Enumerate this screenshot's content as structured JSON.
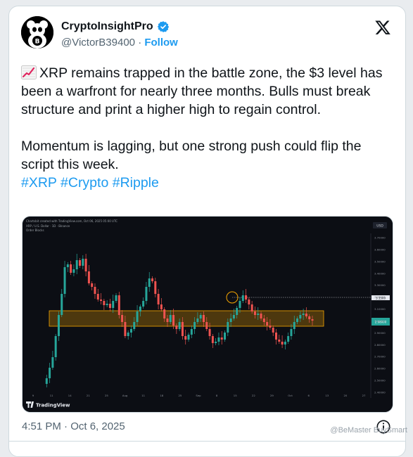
{
  "author": {
    "display_name": "CryptoInsightPro",
    "handle": "@VictorB39400",
    "separator": "·",
    "follow_label": "Follow",
    "verified": true
  },
  "tweet": {
    "emoji_icon": "chart-increasing-icon",
    "paragraph1": "XRP remains trapped in the battle zone, the $3 level has been a warfront for nearly three months. Bulls must break structure and print a higher high to regain control.",
    "paragraph2": "Momentum is lagging, but one strong push could flip the script this week.",
    "hashtags": [
      "#XRP",
      "#Crypto",
      "#Ripple"
    ],
    "timestamp": "4:51 PM · Oct 6, 2025"
  },
  "chart": {
    "header_line1": "Chartsbit created with TradingView.com, Oct 06, 2025 05:00 UTC",
    "header_line2": "XRP / U.S. Dollar · 1D · Binance",
    "header_line3": "Order Blocks",
    "currency_badge": "USD",
    "brand": "TradingView",
    "y_ticks": [
      "3.70000",
      "3.60000",
      "3.50000",
      "3.40000",
      "3.30000",
      "3.20000",
      "3.10000",
      "3.00000",
      "2.90000",
      "2.80000",
      "2.70000",
      "2.60000",
      "2.50000",
      "2.40000"
    ],
    "price_label_high": "3.1500",
    "price_label_current": "2.98000",
    "x_ticks": [
      "9",
      "11",
      "14",
      "21",
      "25",
      "Aug",
      "11",
      "18",
      "25",
      "Sep",
      "8",
      "15",
      "22",
      "29",
      "Oct",
      "6",
      "13",
      "20",
      "27"
    ],
    "colors": {
      "up": "#26a69a",
      "down": "#ef5350",
      "zone": "#f7a600",
      "background": "#0c0e14"
    }
  },
  "watermark": "@BeMaster BuySmart",
  "icons": {
    "x_logo": "x-logo-icon",
    "info": "info-icon",
    "verified": "verified-badge-icon"
  }
}
